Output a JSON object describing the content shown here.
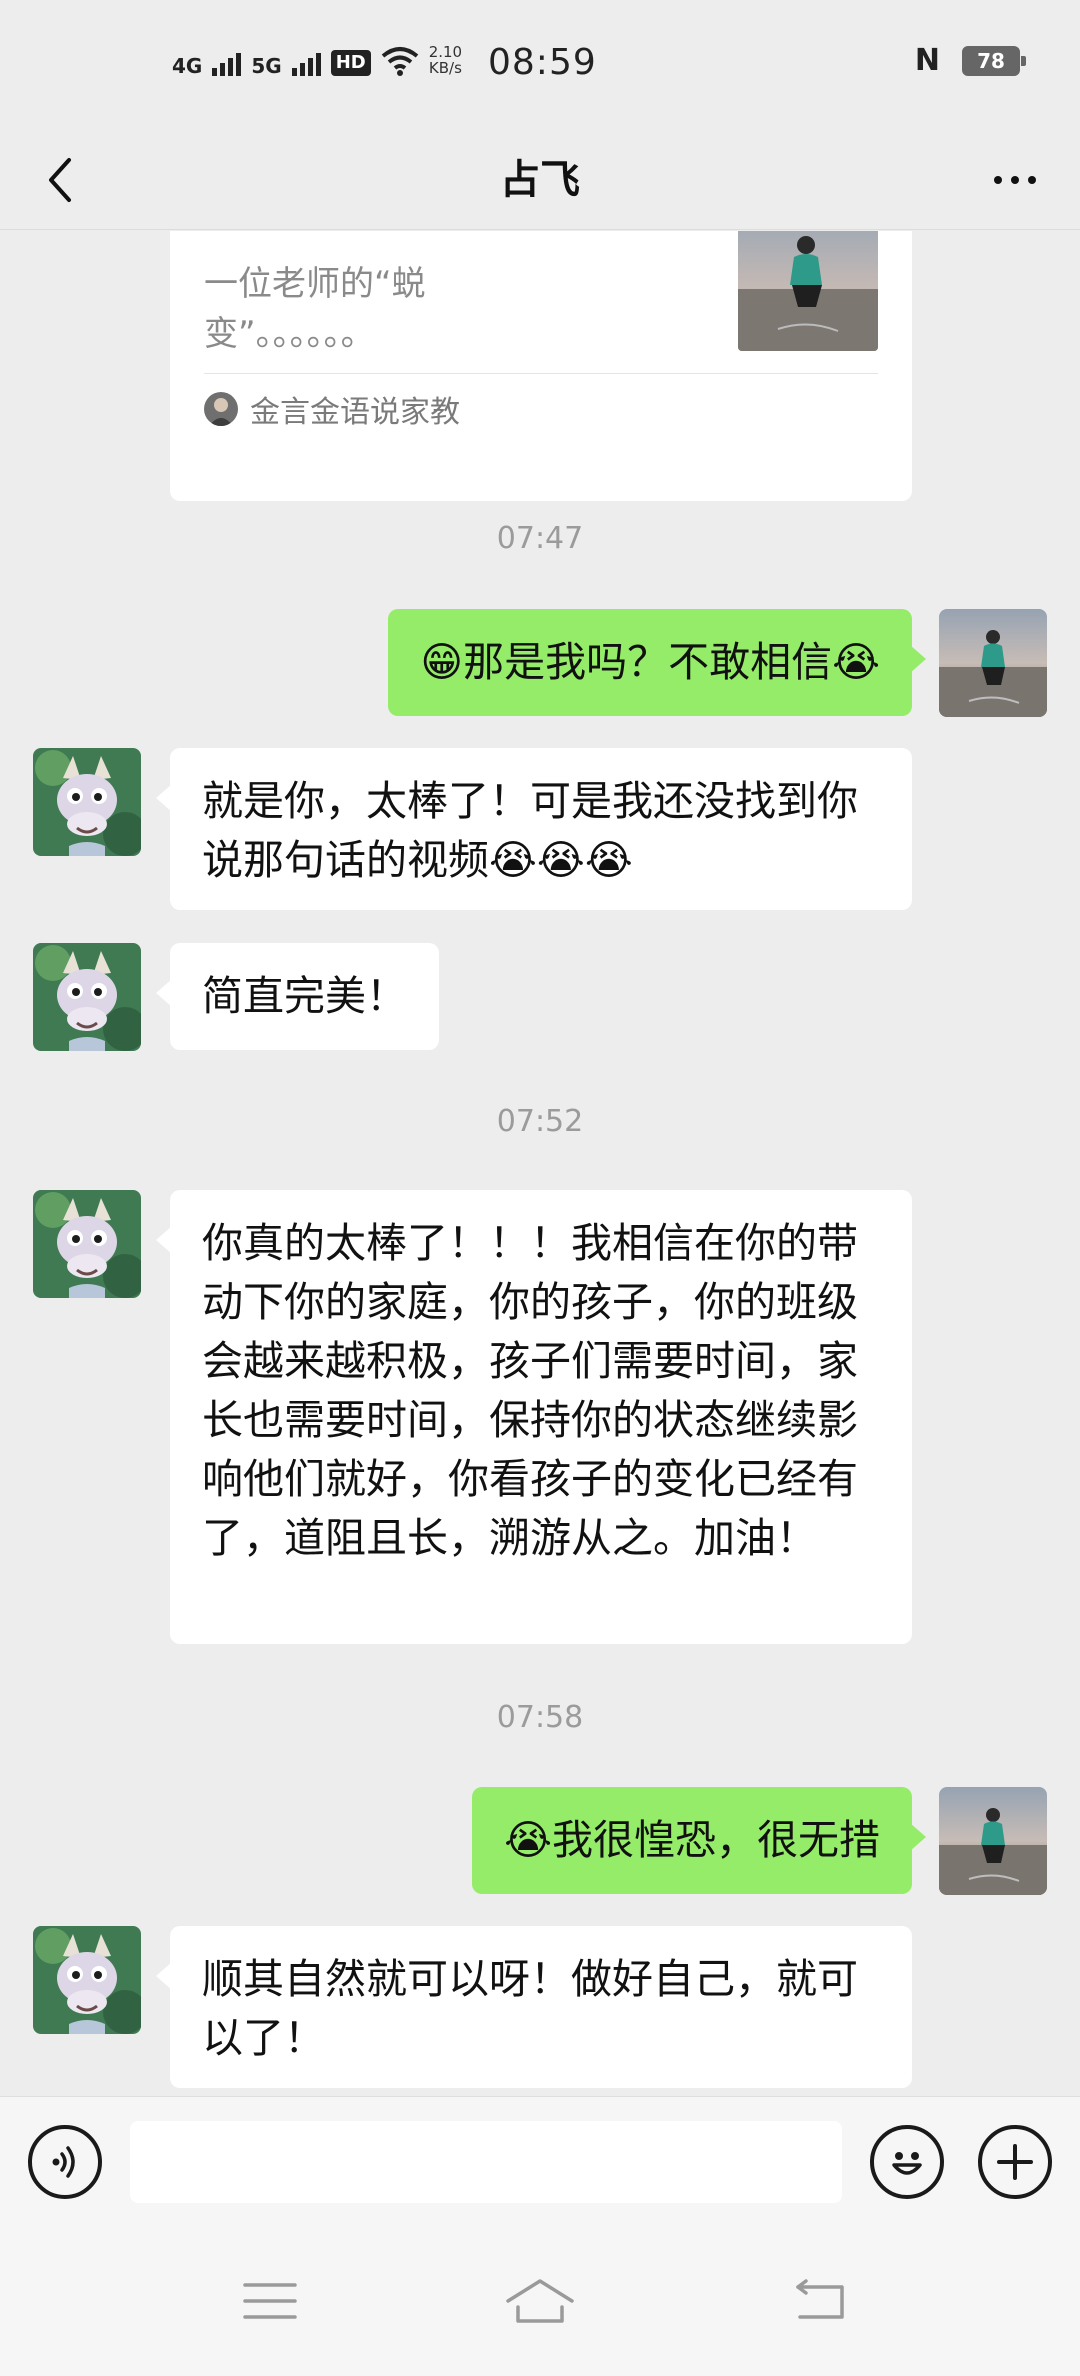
{
  "status_bar": {
    "time": "08:59",
    "net1": "4G",
    "net2": "5G",
    "hd_label": "HD",
    "speed_value": "2.10",
    "speed_unit": "KB/s",
    "nfc": "N",
    "battery": "78"
  },
  "header": {
    "title": "占飞"
  },
  "shared_card": {
    "description": "一位老师的“蜕变”。。。。。。",
    "source": "金言金语说家教"
  },
  "messages": [
    {
      "type": "time",
      "text": "07:47"
    },
    {
      "type": "out",
      "text": "😁那是我吗？不敢相信😭"
    },
    {
      "type": "in",
      "text": "就是你，太棒了！可是我还没找到你说那句话的视频😭😭😭"
    },
    {
      "type": "in",
      "text": "简直完美！"
    },
    {
      "type": "time",
      "text": "07:52"
    },
    {
      "type": "in",
      "text": "你真的太棒了！！！我相信在你的带动下你的家庭，你的孩子，你的班级会越来越积极，孩子们需要时间，家长也需要时间，保持你的状态继续影响他们就好，你看孩子的变化已经有了，道阻且长，溯游从之。加油！"
    },
    {
      "type": "time",
      "text": "07:58"
    },
    {
      "type": "out",
      "text": "😭我很惶恐，很无措"
    },
    {
      "type": "in",
      "text": "顺其自然就可以呀！做好自己，就可以了！"
    }
  ],
  "icons": {
    "back": "chevron-left-icon",
    "more": "more-dots-icon",
    "voice": "voice-icon",
    "emoji": "emoji-icon",
    "plus": "plus-icon",
    "menu": "menu-icon",
    "home": "home-icon",
    "back_nav": "back-nav-icon"
  },
  "colors": {
    "background": "#ededed",
    "bubble_out": "#95ec69",
    "bubble_in": "#ffffff"
  }
}
